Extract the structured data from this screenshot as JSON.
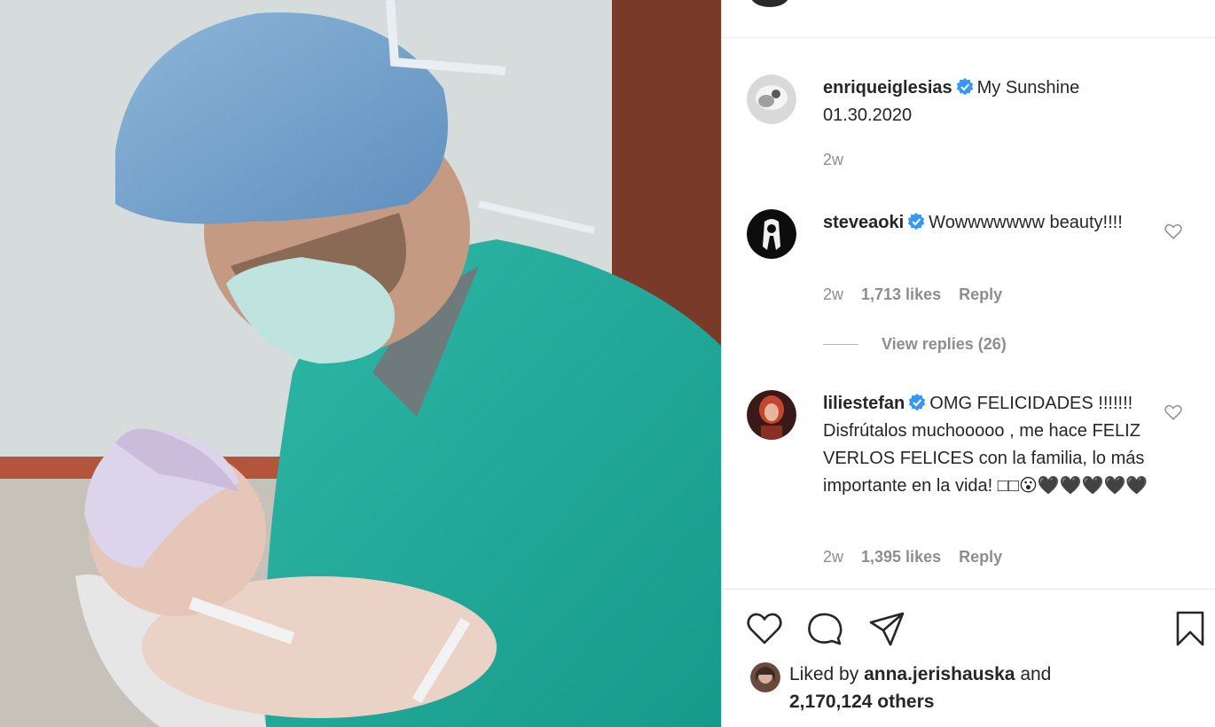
{
  "caption": {
    "username": "enriqueiglesias",
    "text": "My Sunshine 01.30.2020",
    "time": "2w"
  },
  "comments": [
    {
      "username": "steveaoki",
      "text": "Wowwwwwww beauty!!!!",
      "time": "2w",
      "likes": "1,713 likes",
      "reply": "Reply",
      "view_replies": "View replies (26)"
    },
    {
      "username": "liliestefan",
      "text": "OMG FELICIDADES !!!!!!! Disfrútalos muchooooo , me hace FELIZ VERLOS FELICES con la familia, lo más importante en la vida! □□😮🖤🖤🖤🖤🖤",
      "time": "2w",
      "likes": "1,395 likes",
      "reply": "Reply"
    }
  ],
  "liked_by": {
    "prefix": "Liked by",
    "user": "anna.jerishauska",
    "conjunction": "and",
    "others": "2,170,124 others"
  },
  "icons": {
    "like": "heart-icon",
    "comment": "comment-icon",
    "share": "paper-plane-icon",
    "save": "bookmark-icon",
    "verified": "verified-badge-icon"
  },
  "colors": {
    "verified": "#3897f0",
    "text": "#262626",
    "muted": "#8e8e8e"
  }
}
